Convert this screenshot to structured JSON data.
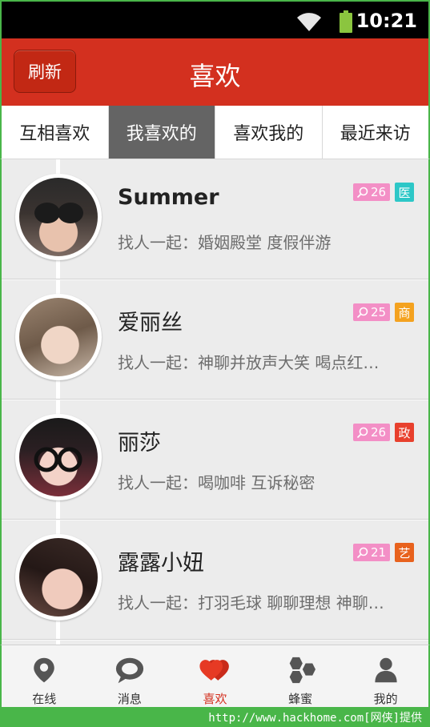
{
  "status": {
    "time": "10:21"
  },
  "header": {
    "refresh_label": "刷新",
    "title": "喜欢"
  },
  "tabs": [
    {
      "label": "互相喜欢",
      "active": false
    },
    {
      "label": "我喜欢的",
      "active": true
    },
    {
      "label": "喜欢我的",
      "active": false
    },
    {
      "label": "最近来访",
      "active": false
    }
  ],
  "users": [
    {
      "name": "Summer",
      "desc": "找人一起：婚姻殿堂 度假伴游",
      "badge_count": "26",
      "tag": "医",
      "tag_color": "#2dc7c7"
    },
    {
      "name": "爱丽丝",
      "desc": "找人一起：神聊并放声大笑 喝点红…",
      "badge_count": "25",
      "tag": "商",
      "tag_color": "#f4a21f"
    },
    {
      "name": "丽莎",
      "desc": "找人一起：喝咖啡 互诉秘密",
      "badge_count": "26",
      "tag": "政",
      "tag_color": "#e8402d"
    },
    {
      "name": "露露小妞",
      "desc": "找人一起：打羽毛球 聊聊理想 神聊…",
      "badge_count": "21",
      "tag": "艺",
      "tag_color": "#e8621d"
    }
  ],
  "nav": [
    {
      "label": "在线",
      "icon": "location-pin-icon"
    },
    {
      "label": "消息",
      "icon": "chat-bubble-icon"
    },
    {
      "label": "喜欢",
      "icon": "hearts-icon",
      "active": true
    },
    {
      "label": "蜂蜜",
      "icon": "honeycomb-icon"
    },
    {
      "label": "我的",
      "icon": "person-icon"
    }
  ],
  "footer": {
    "watermark": "http://www.hackhome.com[网侠]提供"
  },
  "colors": {
    "accent": "#d3301f",
    "badge": "#f38fc6",
    "frame": "#49b649"
  }
}
